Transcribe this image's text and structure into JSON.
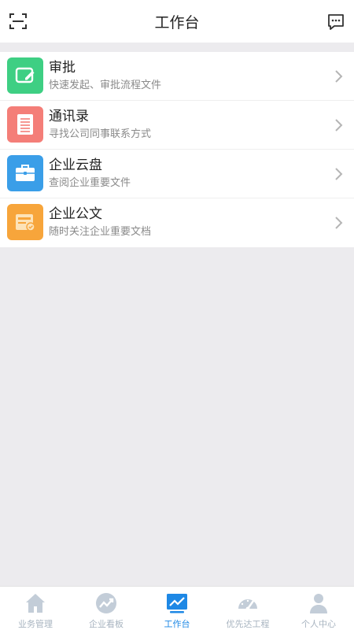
{
  "header": {
    "title": "工作台"
  },
  "items": [
    {
      "title": "审批",
      "subtitle": "快速发起、审批流程文件",
      "color": "#3ecf83",
      "icon": "edit-icon"
    },
    {
      "title": "通讯录",
      "subtitle": "寻找公司同事联系方式",
      "color": "#f47e78",
      "icon": "document-list-icon"
    },
    {
      "title": "企业云盘",
      "subtitle": "查阅企业重要文件",
      "color": "#3a9ee8",
      "icon": "briefcase-icon"
    },
    {
      "title": "企业公文",
      "subtitle": "随时关注企业重要文档",
      "color": "#f7a53b",
      "icon": "official-doc-icon"
    }
  ],
  "tabs": [
    {
      "label": "业务管理",
      "icon": "home-icon",
      "active": false
    },
    {
      "label": "企业看板",
      "icon": "trend-circle-icon",
      "active": false
    },
    {
      "label": "工作台",
      "icon": "line-chart-icon",
      "active": true
    },
    {
      "label": "优先达工程",
      "icon": "gauge-icon",
      "active": false
    },
    {
      "label": "个人中心",
      "icon": "person-icon",
      "active": false
    }
  ],
  "colors": {
    "active": "#1e88e5",
    "inactive": "#c3cdd8"
  }
}
